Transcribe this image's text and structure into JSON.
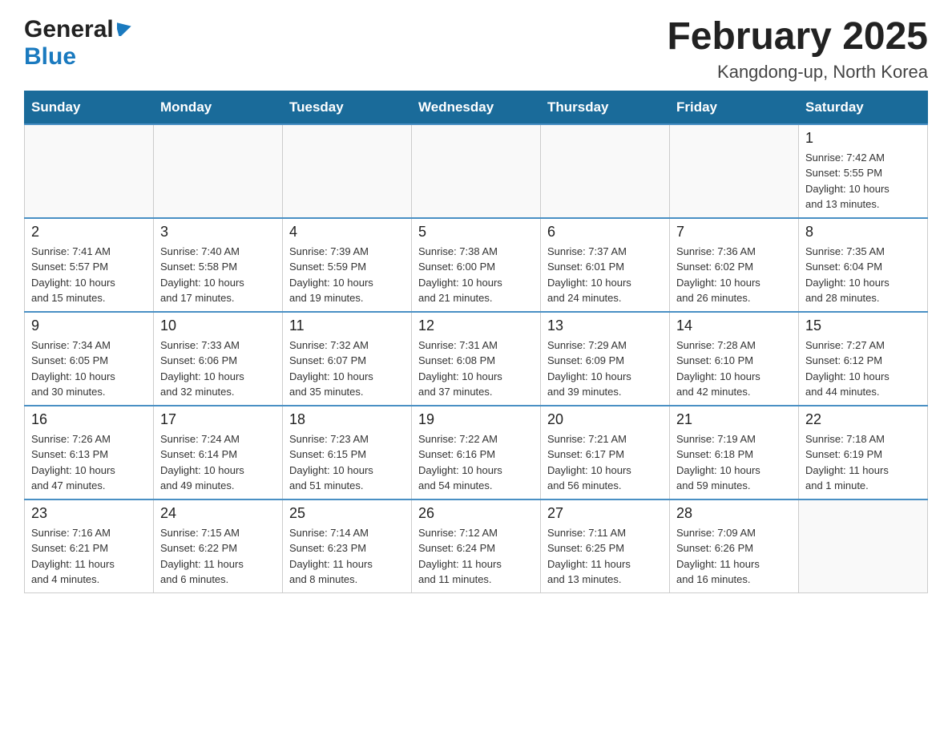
{
  "header": {
    "logo_general": "General",
    "logo_blue": "Blue",
    "title": "February 2025",
    "subtitle": "Kangdong-up, North Korea"
  },
  "weekdays": [
    "Sunday",
    "Monday",
    "Tuesday",
    "Wednesday",
    "Thursday",
    "Friday",
    "Saturday"
  ],
  "weeks": [
    [
      {
        "day": "",
        "info": ""
      },
      {
        "day": "",
        "info": ""
      },
      {
        "day": "",
        "info": ""
      },
      {
        "day": "",
        "info": ""
      },
      {
        "day": "",
        "info": ""
      },
      {
        "day": "",
        "info": ""
      },
      {
        "day": "1",
        "info": "Sunrise: 7:42 AM\nSunset: 5:55 PM\nDaylight: 10 hours\nand 13 minutes."
      }
    ],
    [
      {
        "day": "2",
        "info": "Sunrise: 7:41 AM\nSunset: 5:57 PM\nDaylight: 10 hours\nand 15 minutes."
      },
      {
        "day": "3",
        "info": "Sunrise: 7:40 AM\nSunset: 5:58 PM\nDaylight: 10 hours\nand 17 minutes."
      },
      {
        "day": "4",
        "info": "Sunrise: 7:39 AM\nSunset: 5:59 PM\nDaylight: 10 hours\nand 19 minutes."
      },
      {
        "day": "5",
        "info": "Sunrise: 7:38 AM\nSunset: 6:00 PM\nDaylight: 10 hours\nand 21 minutes."
      },
      {
        "day": "6",
        "info": "Sunrise: 7:37 AM\nSunset: 6:01 PM\nDaylight: 10 hours\nand 24 minutes."
      },
      {
        "day": "7",
        "info": "Sunrise: 7:36 AM\nSunset: 6:02 PM\nDaylight: 10 hours\nand 26 minutes."
      },
      {
        "day": "8",
        "info": "Sunrise: 7:35 AM\nSunset: 6:04 PM\nDaylight: 10 hours\nand 28 minutes."
      }
    ],
    [
      {
        "day": "9",
        "info": "Sunrise: 7:34 AM\nSunset: 6:05 PM\nDaylight: 10 hours\nand 30 minutes."
      },
      {
        "day": "10",
        "info": "Sunrise: 7:33 AM\nSunset: 6:06 PM\nDaylight: 10 hours\nand 32 minutes."
      },
      {
        "day": "11",
        "info": "Sunrise: 7:32 AM\nSunset: 6:07 PM\nDaylight: 10 hours\nand 35 minutes."
      },
      {
        "day": "12",
        "info": "Sunrise: 7:31 AM\nSunset: 6:08 PM\nDaylight: 10 hours\nand 37 minutes."
      },
      {
        "day": "13",
        "info": "Sunrise: 7:29 AM\nSunset: 6:09 PM\nDaylight: 10 hours\nand 39 minutes."
      },
      {
        "day": "14",
        "info": "Sunrise: 7:28 AM\nSunset: 6:10 PM\nDaylight: 10 hours\nand 42 minutes."
      },
      {
        "day": "15",
        "info": "Sunrise: 7:27 AM\nSunset: 6:12 PM\nDaylight: 10 hours\nand 44 minutes."
      }
    ],
    [
      {
        "day": "16",
        "info": "Sunrise: 7:26 AM\nSunset: 6:13 PM\nDaylight: 10 hours\nand 47 minutes."
      },
      {
        "day": "17",
        "info": "Sunrise: 7:24 AM\nSunset: 6:14 PM\nDaylight: 10 hours\nand 49 minutes."
      },
      {
        "day": "18",
        "info": "Sunrise: 7:23 AM\nSunset: 6:15 PM\nDaylight: 10 hours\nand 51 minutes."
      },
      {
        "day": "19",
        "info": "Sunrise: 7:22 AM\nSunset: 6:16 PM\nDaylight: 10 hours\nand 54 minutes."
      },
      {
        "day": "20",
        "info": "Sunrise: 7:21 AM\nSunset: 6:17 PM\nDaylight: 10 hours\nand 56 minutes."
      },
      {
        "day": "21",
        "info": "Sunrise: 7:19 AM\nSunset: 6:18 PM\nDaylight: 10 hours\nand 59 minutes."
      },
      {
        "day": "22",
        "info": "Sunrise: 7:18 AM\nSunset: 6:19 PM\nDaylight: 11 hours\nand 1 minute."
      }
    ],
    [
      {
        "day": "23",
        "info": "Sunrise: 7:16 AM\nSunset: 6:21 PM\nDaylight: 11 hours\nand 4 minutes."
      },
      {
        "day": "24",
        "info": "Sunrise: 7:15 AM\nSunset: 6:22 PM\nDaylight: 11 hours\nand 6 minutes."
      },
      {
        "day": "25",
        "info": "Sunrise: 7:14 AM\nSunset: 6:23 PM\nDaylight: 11 hours\nand 8 minutes."
      },
      {
        "day": "26",
        "info": "Sunrise: 7:12 AM\nSunset: 6:24 PM\nDaylight: 11 hours\nand 11 minutes."
      },
      {
        "day": "27",
        "info": "Sunrise: 7:11 AM\nSunset: 6:25 PM\nDaylight: 11 hours\nand 13 minutes."
      },
      {
        "day": "28",
        "info": "Sunrise: 7:09 AM\nSunset: 6:26 PM\nDaylight: 11 hours\nand 16 minutes."
      },
      {
        "day": "",
        "info": ""
      }
    ]
  ]
}
